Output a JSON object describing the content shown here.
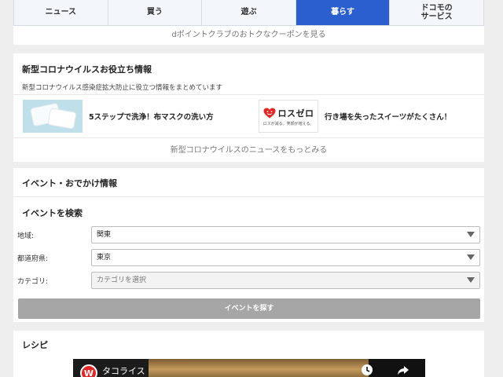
{
  "nav": {
    "tabs": [
      {
        "label": "ニュース",
        "active": false
      },
      {
        "label": "買う",
        "active": false
      },
      {
        "label": "遊ぶ",
        "active": false
      },
      {
        "label": "暮らす",
        "active": true
      },
      {
        "label": "ドコモの\nサービス",
        "active": false
      }
    ]
  },
  "coupon": {
    "link": "dポイントクラブのおトクなクーポンを見る"
  },
  "corona": {
    "title": "新型コロナウイルスお役立ち情報",
    "description": "新型コロナウイルス感染症拡大防止に役立つ情報をまとめています",
    "articles": [
      {
        "title": "5ステップで洗浄！布マスクの洗い方"
      },
      {
        "title": "行き場を失ったスイーツがたくさん！",
        "logo_text": "ロスゼロ",
        "logo_sub": "ロスが減る。笑顔が増える。"
      }
    ],
    "more": "新型コロナウイルスのニュースをもっとみる"
  },
  "events": {
    "title": "イベント・おでかけ情報",
    "search_title": "イベントを検索",
    "fields": [
      {
        "label": "地域:",
        "value": "関東"
      },
      {
        "label": "都道府県:",
        "value": "東京"
      },
      {
        "label": "カテゴリ:",
        "value": "カテゴリを選択"
      }
    ],
    "search_button": "イベントを探す"
  },
  "recipe": {
    "title": "レシピ",
    "video_title": "タコライス",
    "channel_initial": "W"
  },
  "colors": {
    "accent": "#2b5fcf",
    "button_disabled": "#a6a6a6",
    "logo_red": "#e32626"
  }
}
